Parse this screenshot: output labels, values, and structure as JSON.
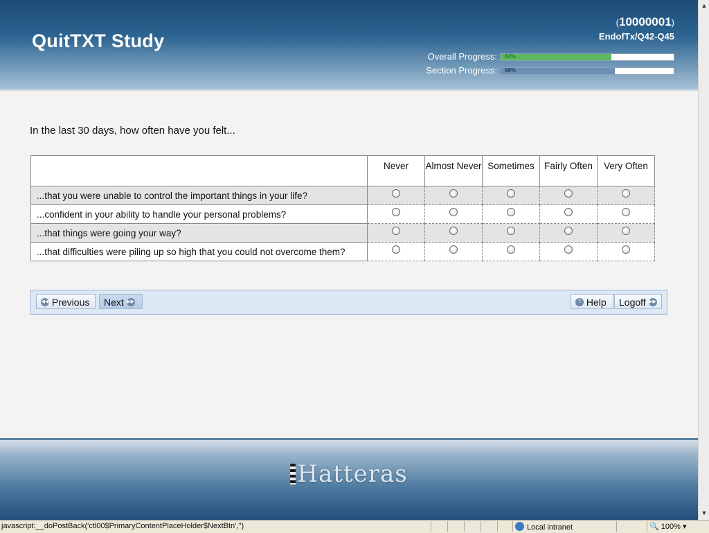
{
  "header": {
    "study_title": "QuitTXT Study",
    "participant_id": "10000001",
    "paren_open": "(",
    "paren_close": ")",
    "location": "EndofTx/Q42-Q45",
    "overall_progress": {
      "label": "Overall Progress:",
      "percent": 64,
      "text": "64%",
      "color": "#5cb85c"
    },
    "section_progress": {
      "label": "Section Progress:",
      "percent": 66,
      "text": "66%",
      "color": "#6b8fb3"
    }
  },
  "question": {
    "prompt": "In the last 30 days, how often have you felt...",
    "columns": [
      "Never",
      "Almost Never",
      "Sometimes",
      "Fairly Often",
      "Very Often"
    ],
    "items": [
      "...that you were unable to control the important things in your life?",
      "...confident in your ability to handle your personal problems?",
      "...that things were going your way?",
      "...that difficulties were piling up so high that you could not overcome them?"
    ]
  },
  "nav": {
    "previous_label": "Previous",
    "next_label": "Next",
    "help_label": "Help",
    "logoff_label": "Logoff"
  },
  "footer": {
    "brand": "Hatteras"
  },
  "statusbar": {
    "status_text": "javascript:__doPostBack('ctl00$PrimaryContentPlaceHolder$NextBtn','')",
    "zone": "Local intranet",
    "zoom": "100%"
  },
  "icons": {
    "previous": "rewind-circle-icon",
    "next": "fast-forward-circle-icon",
    "help": "question-circle-icon",
    "logoff": "fast-forward-circle-icon",
    "zone": "globe-icon"
  }
}
